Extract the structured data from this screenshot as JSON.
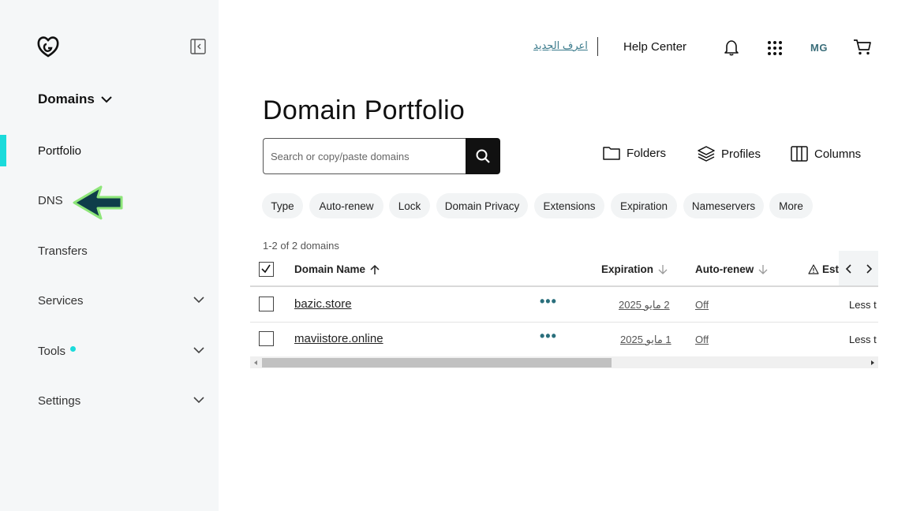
{
  "sidebar": {
    "section_title": "Domains",
    "items": [
      {
        "label": "Portfolio"
      },
      {
        "label": "DNS"
      },
      {
        "label": "Transfers"
      },
      {
        "label": "Services"
      },
      {
        "label": "Tools"
      },
      {
        "label": "Settings"
      }
    ]
  },
  "topbar": {
    "whats_new": "اعرف الجديد",
    "help_center": "Help Center",
    "avatar_initials": "MG"
  },
  "main": {
    "title": "Domain Portfolio",
    "search_placeholder": "Search or copy/paste domains",
    "tools": {
      "folders": "Folders",
      "profiles": "Profiles",
      "columns": "Columns"
    },
    "filters": [
      "Type",
      "Auto-renew",
      "Lock",
      "Domain Privacy",
      "Extensions",
      "Expiration",
      "Nameservers",
      "More"
    ],
    "count": "1-2 of 2 domains",
    "columns": {
      "domain": "Domain Name",
      "expiration": "Expiration",
      "autorenew": "Auto-renew",
      "est": "Est"
    },
    "rows": [
      {
        "domain": "bazic.store",
        "expiration": "2 مايو 2025",
        "autorenew": "Off",
        "est": "Less t"
      },
      {
        "domain": "maviistore.online",
        "expiration": "1 مايو 2025",
        "autorenew": "Off",
        "est": "Less t"
      }
    ]
  },
  "colors": {
    "accent": "#1bdbdb",
    "link": "#3b7b8c",
    "arrow_fill": "#0f3d4a",
    "arrow_glow": "#8ee67a"
  }
}
